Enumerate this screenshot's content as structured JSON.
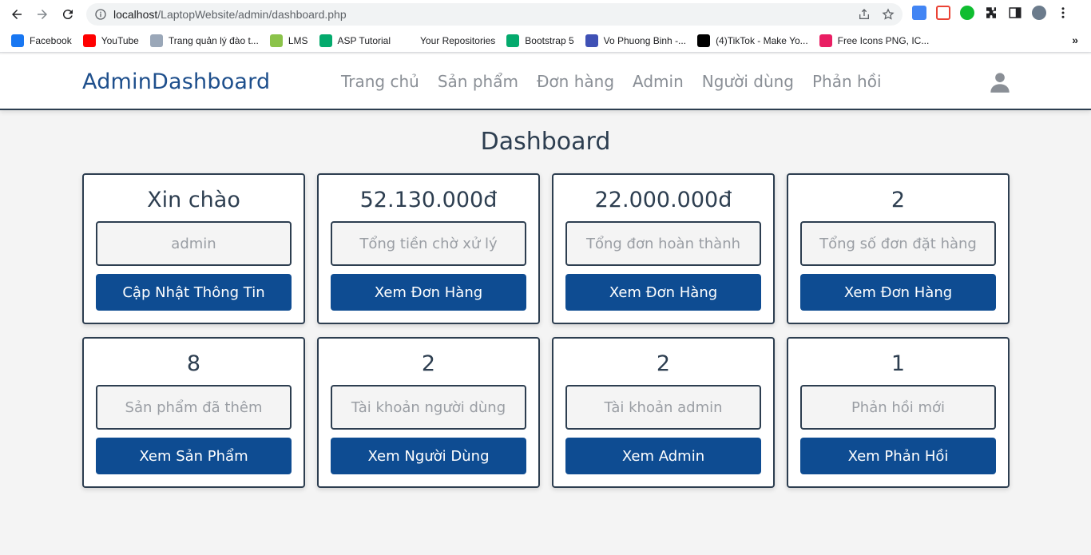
{
  "browser": {
    "url_host": "localhost",
    "url_path": "/LaptopWebsite/admin/dashboard.php",
    "bookmarks": [
      {
        "label": "Facebook",
        "icon": "facebook-icon",
        "color": "#1877f2"
      },
      {
        "label": "YouTube",
        "icon": "youtube-icon",
        "color": "#ff0000"
      },
      {
        "label": "Trang quản lý đào t...",
        "icon": "document-icon",
        "color": "#9aa7b8"
      },
      {
        "label": "LMS",
        "icon": "lms-icon",
        "color": "#8bc34a"
      },
      {
        "label": "ASP Tutorial",
        "icon": "w3schools-icon",
        "color": "#04aa6d"
      },
      {
        "label": "Your Repositories",
        "icon": "github-icon",
        "color": "#ffffff"
      },
      {
        "label": "Bootstrap 5",
        "icon": "w3schools-icon",
        "color": "#04aa6d"
      },
      {
        "label": "Vo Phuong Binh -...",
        "icon": "page-icon",
        "color": "#3f51b5"
      },
      {
        "label": "(4)TikTok - Make Yo...",
        "icon": "tiktok-icon",
        "color": "#000000"
      },
      {
        "label": "Free Icons PNG, IC...",
        "icon": "icons-icon",
        "color": "#e91e63"
      }
    ],
    "more": "»"
  },
  "nav": {
    "brand": "AdminDashboard",
    "items": [
      "Trang chủ",
      "Sản phẩm",
      "Đơn hàng",
      "Admin",
      "Người dùng",
      "Phản hồi"
    ]
  },
  "page": {
    "title": "Dashboard"
  },
  "cards": [
    {
      "value": "Xin chào",
      "box": "admin",
      "button": "Cập Nhật Thông Tin"
    },
    {
      "value": "52.130.000đ",
      "box": "Tổng tiền chờ xử lý",
      "button": "Xem Đơn Hàng"
    },
    {
      "value": "22.000.000đ",
      "box": "Tổng đơn hoàn thành",
      "button": "Xem Đơn Hàng"
    },
    {
      "value": "2",
      "box": "Tổng số đơn đặt hàng",
      "button": "Xem Đơn Hàng"
    },
    {
      "value": "8",
      "box": "Sản phẩm đã thêm",
      "button": "Xem Sản Phẩm"
    },
    {
      "value": "2",
      "box": "Tài khoản người dùng",
      "button": "Xem Người Dùng"
    },
    {
      "value": "2",
      "box": "Tài khoản admin",
      "button": "Xem Admin"
    },
    {
      "value": "1",
      "box": "Phản hồi mới",
      "button": "Xem Phản Hồi"
    }
  ],
  "colors": {
    "brand": "#1e4f8c",
    "button": "#0e4c92",
    "border": "#2d3e50"
  }
}
